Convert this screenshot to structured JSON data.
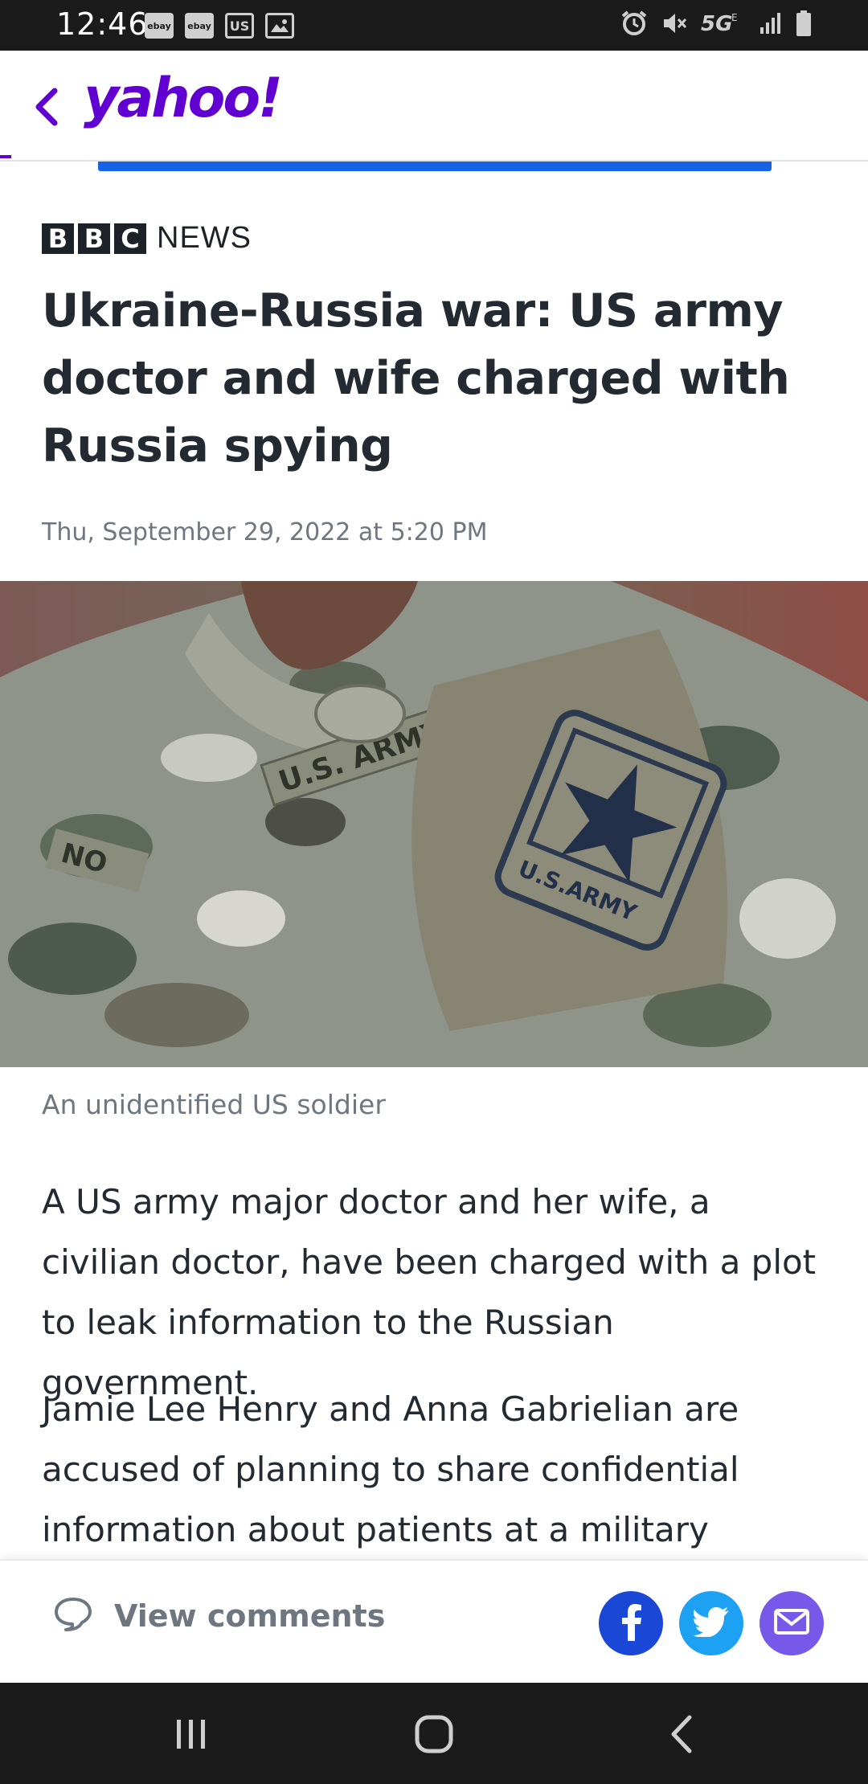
{
  "status_bar": {
    "time": "12:46",
    "notifications": [
      "ebay-icon",
      "ebay-icon",
      "us-icon",
      "image-icon"
    ],
    "notification_labels": [
      "ebay",
      "ebay",
      "US"
    ],
    "network": "5G"
  },
  "header": {
    "logo": "yahoo!",
    "back_icon": "chevron-left-icon",
    "brand_color": "#6001d2",
    "progress_color": "#1664e5"
  },
  "article": {
    "source_blocks": [
      "B",
      "B",
      "C"
    ],
    "source_suffix": "NEWS",
    "headline": "Ukraine-Russia war: US army doctor and wife charged with Russia spying",
    "date": "Thu, September 29, 2022 at 5:20 PM",
    "image_caption": "An unidentified US soldier",
    "paragraphs": [
      "A US army major doctor and her wife, a civilian doctor, have been charged with a plot to leak information to the Russian government.",
      "Jamie Lee Henry and Anna Gabrielian are accused of planning to share confidential information about patients at a military"
    ]
  },
  "image_text": {
    "name_tape": "U.S. ARMY",
    "patch": "U.S. ARMY",
    "left_tape": "NO"
  },
  "action_bar": {
    "comments_label": "View comments",
    "share": [
      {
        "name": "facebook",
        "color": "#1a47d6"
      },
      {
        "name": "twitter",
        "color": "#1da1f2"
      },
      {
        "name": "email",
        "color": "#7759e9"
      }
    ]
  },
  "nav_bar": {
    "buttons": [
      "recents-icon",
      "home-icon",
      "back-icon"
    ]
  }
}
